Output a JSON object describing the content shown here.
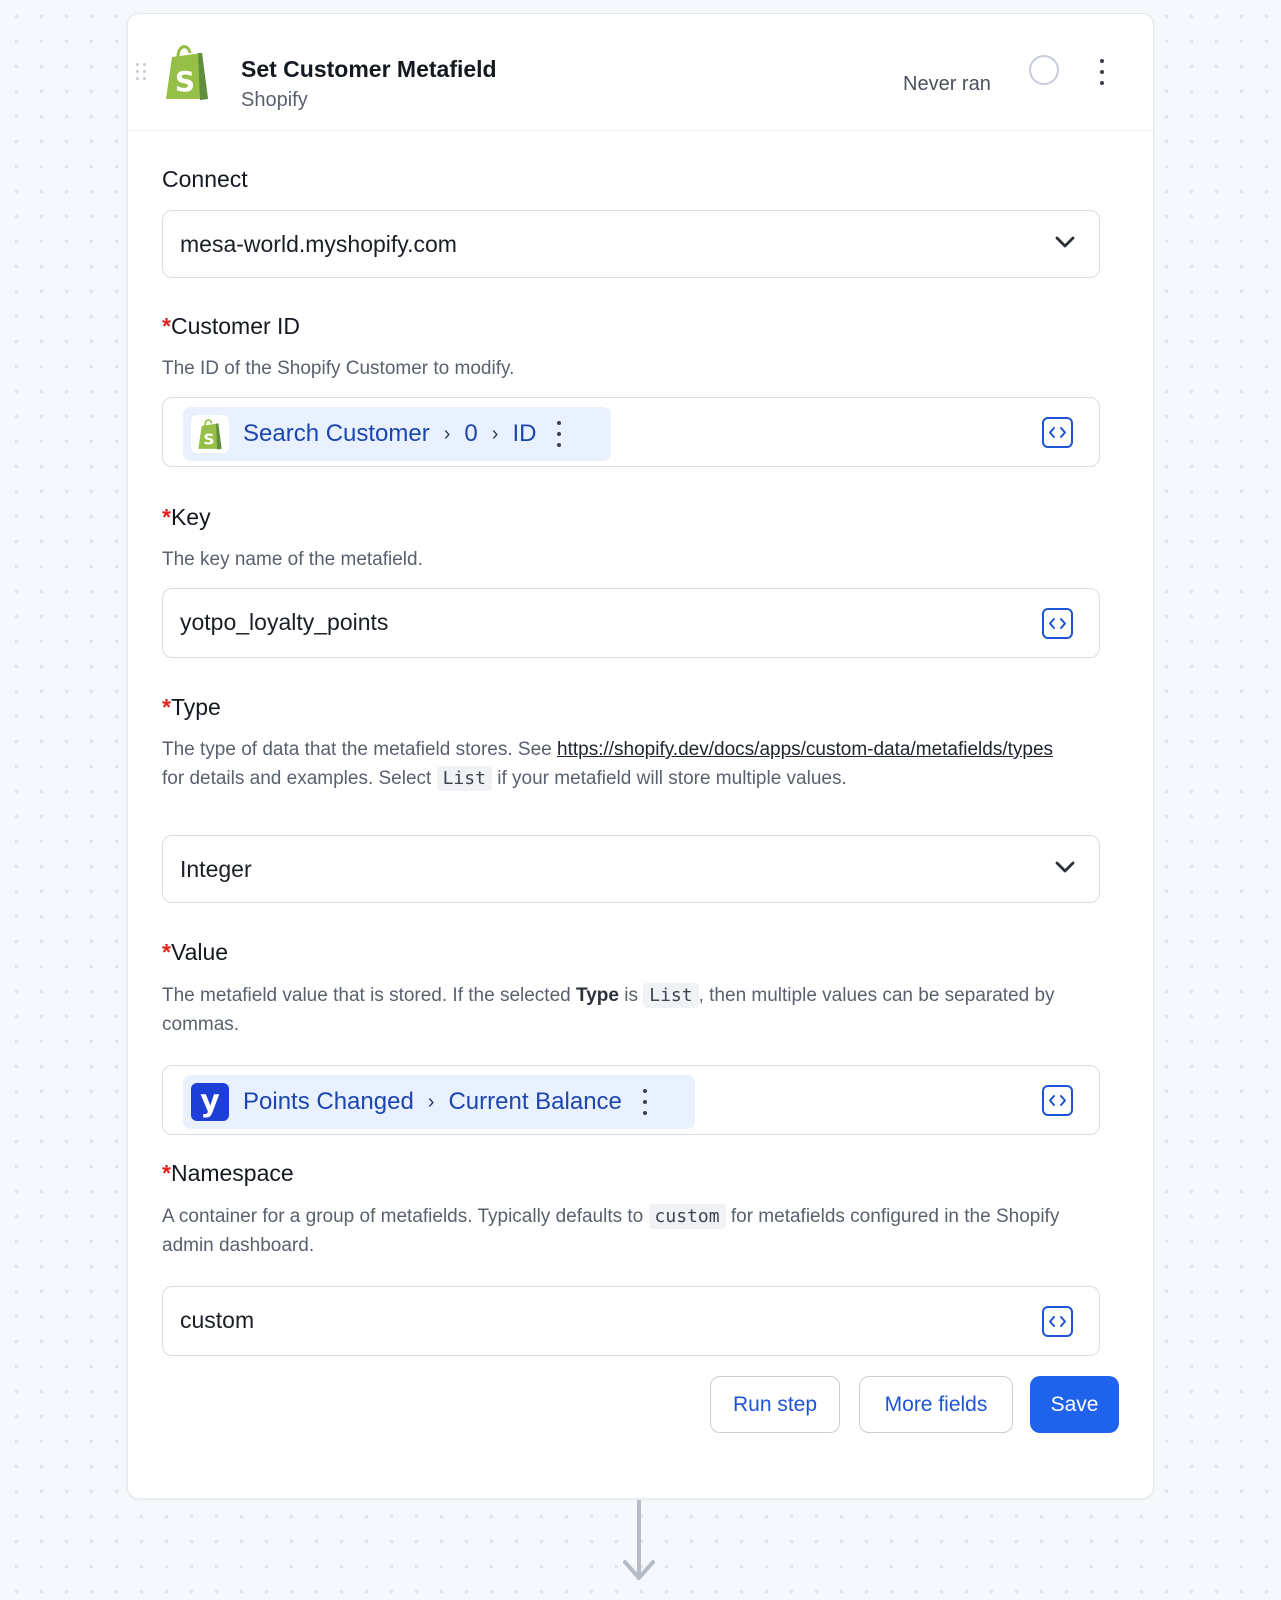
{
  "step": {
    "title": "Set Customer Metafield",
    "app": "Shopify",
    "status": "Never ran"
  },
  "fields": {
    "connect": {
      "label": "Connect",
      "value": "mesa-world.myshopify.com"
    },
    "customer_id": {
      "required_mark": "*",
      "label": "Customer ID",
      "help": "The ID of the Shopify Customer to modify.",
      "token": {
        "icon": "shopify-bag-icon",
        "segments": [
          "Search Customer",
          "0",
          "ID"
        ],
        "separator": "›"
      }
    },
    "key": {
      "required_mark": "*",
      "label": "Key",
      "help": "The key name of the metafield.",
      "value": "yotpo_loyalty_points"
    },
    "type": {
      "required_mark": "*",
      "label": "Type",
      "help_part1": "The type of data that the metafield stores. See ",
      "help_link": "https://shopify.dev/docs/apps/custom-data/metafields/types",
      "help_part2": " for details and examples. Select ",
      "help_code": "List",
      "help_part3": " if your metafield will store multiple values.",
      "value": "Integer"
    },
    "value": {
      "required_mark": "*",
      "label": "Value",
      "help_part1": "The metafield value that is stored. If the selected ",
      "help_bold": "Type",
      "help_part2": " is ",
      "help_code": "List",
      "help_part3": ", then multiple values can be separated by commas.",
      "token": {
        "icon": "yotpo-icon",
        "icon_letter": "y",
        "segments": [
          "Points Changed",
          "Current Balance"
        ],
        "separator": "›"
      }
    },
    "namespace": {
      "required_mark": "*",
      "label": "Namespace",
      "help_part1": "A container for a group of metafields. Typically defaults to ",
      "help_code": "custom",
      "help_part2": " for metafields configured in the Shopify admin dashboard.",
      "value": "custom"
    }
  },
  "actions": {
    "run_step": "Run step",
    "more_fields": "More fields",
    "save": "Save"
  },
  "colors": {
    "accent": "#1f62eb",
    "required": "#e0241f",
    "shopify_green": "#95bf47",
    "yotpo_blue": "#1d3fd6",
    "token_bg": "#e8f1fd"
  }
}
